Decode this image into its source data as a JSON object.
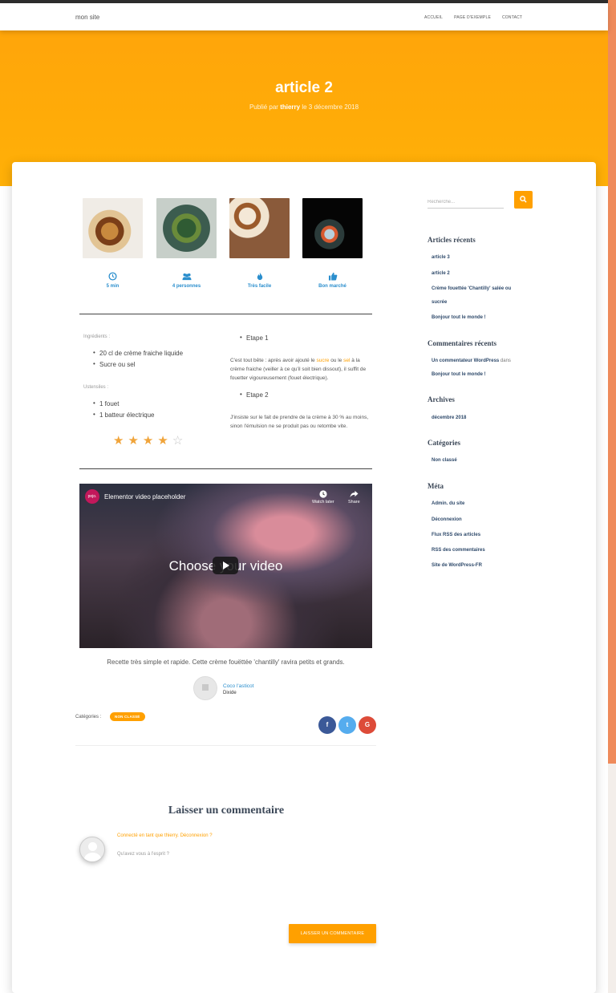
{
  "site": {
    "brand": "mon site"
  },
  "nav": {
    "items": [
      "ACCUEIL",
      "PAGE D'EXEMPLE",
      "CONTACT"
    ]
  },
  "hero": {
    "title": "article 2",
    "published_prefix": "Publié par",
    "author": "thierry",
    "date_text": "le 3 décembre 2018"
  },
  "recipe_meta": [
    {
      "icon": "clock-icon",
      "label": "5 min"
    },
    {
      "icon": "users-icon",
      "label": "4 personnes"
    },
    {
      "icon": "flame-icon",
      "label": "Très facile"
    },
    {
      "icon": "thumbs-up-icon",
      "label": "Bon marché"
    }
  ],
  "ingredients": {
    "label": "Ingrédients :",
    "items": [
      "20 cl de crème fraiche liquide",
      "Sucre ou sel"
    ]
  },
  "ustensiles": {
    "label": "Ustensiles :",
    "items": [
      "1 fouet",
      "1 batteur électrique"
    ]
  },
  "rating": {
    "value": 4,
    "max": 5
  },
  "steps": {
    "step1": "Etape 1",
    "step1_text_a": "C'est tout bête : après avoir ajouté le ",
    "step1_hl1": "sucre",
    "step1_text_b": " ou le ",
    "step1_hl2": "sel",
    "step1_text_c": " à la crème fraiche (veiller à ce qu'il soit bien dissout), il suffit de fouetter vigoureusement (fouet électrique).",
    "step2": "Etape 2",
    "step2_text": "J'insiste sur le fait de prendre de la crème à 30 % au moins, sinon l'émulsion ne se produit pas ou retombe vite."
  },
  "video": {
    "logo": "pojo.",
    "title": "Elementor video placeholder",
    "watch_later": "Watch later",
    "share": "Share",
    "big_text": "Choose your video"
  },
  "caption": "Recette très simple et rapide. Cette crème fouëttée 'chantilly' ravira petits et grands.",
  "author_box": {
    "name": "Coco l'asticot",
    "subtitle": "Dixide"
  },
  "categories": {
    "label": "Catégories :",
    "badge": "NON CLASSÉ"
  },
  "share": {
    "facebook": "f",
    "twitter": "t",
    "google": "G"
  },
  "comment": {
    "heading": "Laisser un commentaire",
    "logged_in": "Connecté en tant que thierry. Déconnexion ?",
    "prompt": "Qu'avez vous à l'esprit ?",
    "submit": "LAISSER UN COMMENTAIRE"
  },
  "sidebar": {
    "search_placeholder": "Recherche...",
    "recent_posts_title": "Articles récents",
    "recent_posts": [
      "article 3",
      "article 2",
      "Crème fouettée 'Chantilly' salée ou",
      "sucrée",
      "Bonjour tout le monde !"
    ],
    "recent_comments_title": "Commentaires récents",
    "recent_comment_author": "Un commentateur WordPress",
    "recent_comment_in": "dans",
    "recent_comment_post": "Bonjour tout le monde !",
    "archives_title": "Archives",
    "archives": [
      "décembre 2018"
    ],
    "categories_title": "Catégories",
    "categories": [
      "Non classé"
    ],
    "meta_title": "Méta",
    "meta": [
      "Admin. du site",
      "Déconnexion",
      "Flux RSS des articles",
      "RSS des commentaires",
      "Site de WordPress-FR"
    ]
  },
  "colors": {
    "accent": "#ffa000",
    "link": "#2a8ecd",
    "facebook": "#3b5998",
    "twitter": "#55acee",
    "google": "#dd4b39"
  }
}
